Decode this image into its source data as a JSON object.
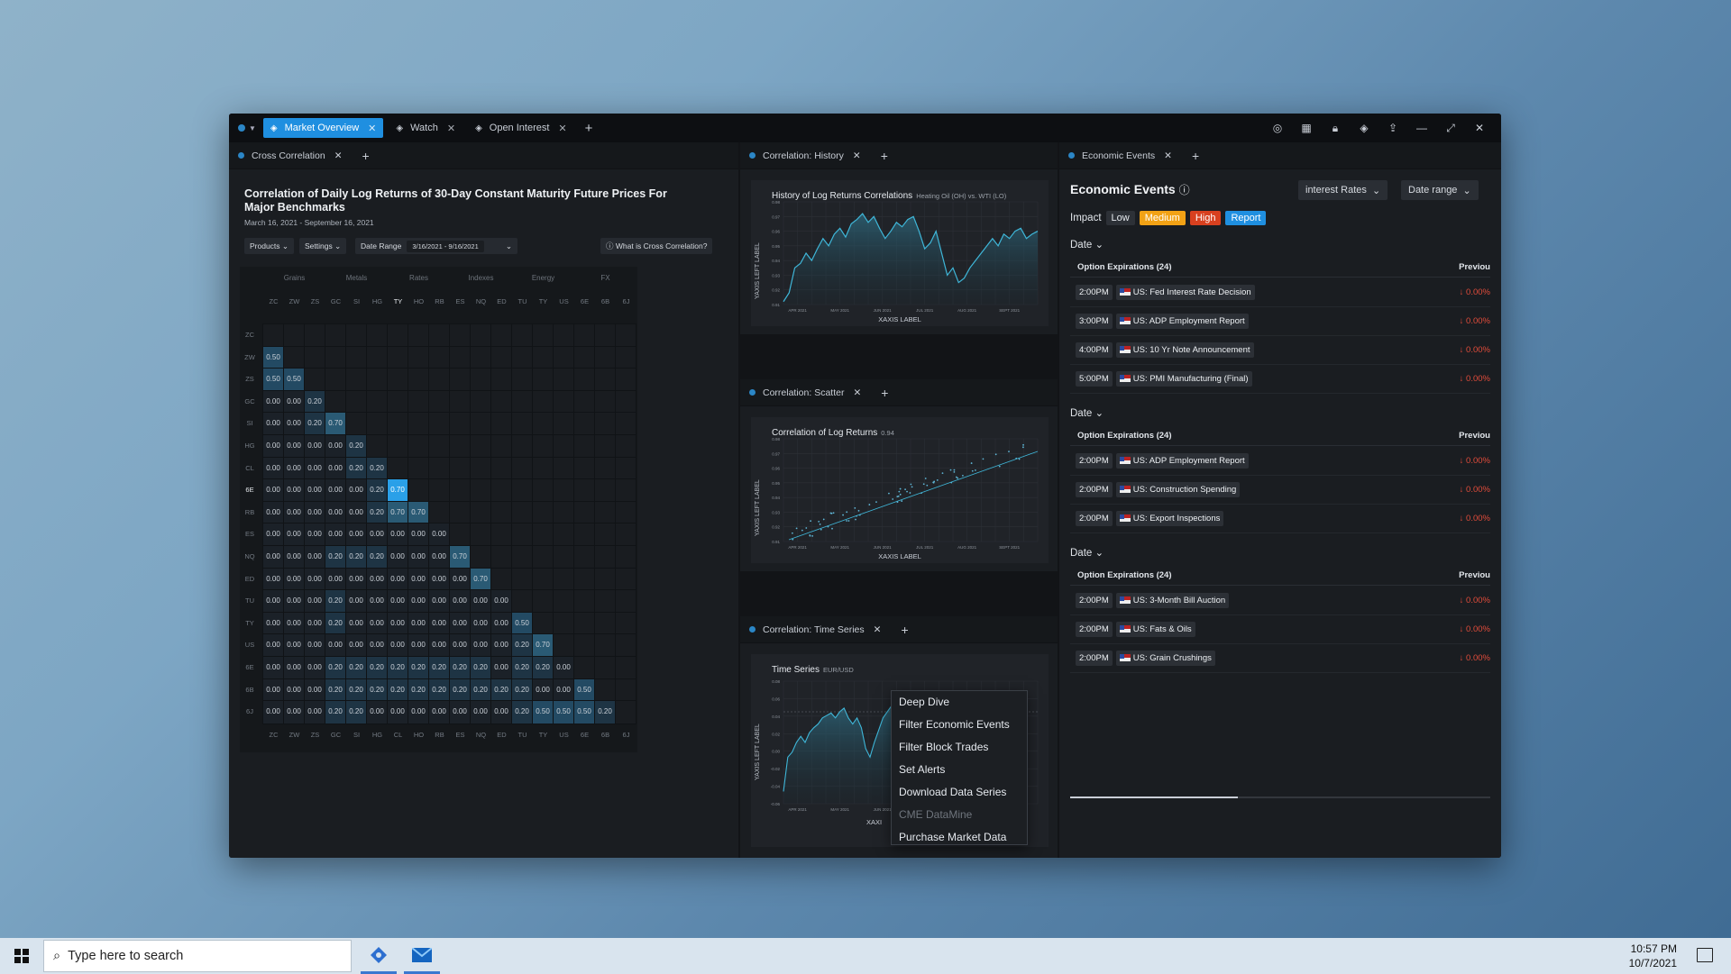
{
  "window": {
    "tabs": [
      {
        "label": "Market Overview",
        "active": true
      },
      {
        "label": "Watch"
      },
      {
        "label": "Open Interest"
      }
    ],
    "controls": [
      "target-icon",
      "grid-icon",
      "lock-icon",
      "layers-icon",
      "share-icon",
      "minimize-icon",
      "expand-icon",
      "close-icon"
    ]
  },
  "cross": {
    "tab": "Cross Correlation",
    "title": "Correlation of Daily Log Returns of 30-Day Constant Maturity Future Prices For Major Benchmarks",
    "date": "March 16, 2021 - September 16, 2021",
    "products": "Products",
    "settings": "Settings",
    "date_range_label": "Date Range",
    "date_range_value": "3/16/2021 - 9/16/2021",
    "help": "What is Cross Correlation?",
    "groups": [
      "Grains",
      "Metals",
      "Rates",
      "Indexes",
      "Energy",
      "FX"
    ],
    "cols": [
      "ZC",
      "ZW",
      "ZS",
      "GC",
      "SI",
      "HG",
      "TY",
      "HO",
      "RB",
      "ES",
      "NQ",
      "ED",
      "TU",
      "TY",
      "US",
      "6E",
      "6B",
      "6J"
    ],
    "rows": [
      "ZC",
      "ZW",
      "ZS",
      "GC",
      "SI",
      "HG",
      "CL",
      "6E",
      "RB",
      "ES",
      "NQ",
      "ED",
      "TU",
      "TY",
      "US",
      "6E",
      "6B",
      "6J"
    ],
    "bottom": [
      "ZC",
      "ZW",
      "ZS",
      "GC",
      "SI",
      "HG",
      "CL",
      "HO",
      "RB",
      "ES",
      "NQ",
      "ED",
      "TU",
      "TY",
      "US",
      "6E",
      "6B",
      "6J"
    ],
    "values": [
      [],
      [
        "0.50"
      ],
      [
        "0.50",
        "0.50"
      ],
      [
        "0.00",
        "0.00",
        "0.20"
      ],
      [
        "0.00",
        "0.00",
        "0.20",
        "0.70"
      ],
      [
        "0.00",
        "0.00",
        "0.00",
        "0.00",
        "0.20"
      ],
      [
        "0.00",
        "0.00",
        "0.00",
        "0.00",
        "0.20",
        "0.20"
      ],
      [
        "0.00",
        "0.00",
        "0.00",
        "0.00",
        "0.00",
        "0.20",
        "0.70"
      ],
      [
        "0.00",
        "0.00",
        "0.00",
        "0.00",
        "0.00",
        "0.20",
        "0.70",
        "0.70"
      ],
      [
        "0.00",
        "0.00",
        "0.00",
        "0.00",
        "0.00",
        "0.00",
        "0.00",
        "0.00",
        "0.00"
      ],
      [
        "0.00",
        "0.00",
        "0.00",
        "0.20",
        "0.20",
        "0.20",
        "0.00",
        "0.00",
        "0.00",
        "0.70"
      ],
      [
        "0.00",
        "0.00",
        "0.00",
        "0.00",
        "0.00",
        "0.00",
        "0.00",
        "0.00",
        "0.00",
        "0.00",
        "0.70"
      ],
      [
        "0.00",
        "0.00",
        "0.00",
        "0.20",
        "0.00",
        "0.00",
        "0.00",
        "0.00",
        "0.00",
        "0.00",
        "0.00",
        "0.00"
      ],
      [
        "0.00",
        "0.00",
        "0.00",
        "0.20",
        "0.00",
        "0.00",
        "0.00",
        "0.00",
        "0.00",
        "0.00",
        "0.00",
        "0.00",
        "0.50"
      ],
      [
        "0.00",
        "0.00",
        "0.00",
        "0.00",
        "0.00",
        "0.00",
        "0.00",
        "0.00",
        "0.00",
        "0.00",
        "0.00",
        "0.00",
        "0.20",
        "0.70"
      ],
      [
        "0.00",
        "0.00",
        "0.00",
        "0.20",
        "0.20",
        "0.20",
        "0.20",
        "0.20",
        "0.20",
        "0.20",
        "0.20",
        "0.00",
        "0.20",
        "0.20",
        "0.00"
      ],
      [
        "0.00",
        "0.00",
        "0.00",
        "0.20",
        "0.20",
        "0.20",
        "0.20",
        "0.20",
        "0.20",
        "0.20",
        "0.20",
        "0.20",
        "0.20",
        "0.00",
        "0.00",
        "0.50"
      ],
      [
        "0.00",
        "0.00",
        "0.00",
        "0.20",
        "0.20",
        "0.00",
        "0.00",
        "0.00",
        "0.00",
        "0.00",
        "0.00",
        "0.00",
        "0.20",
        "0.50",
        "0.50",
        "0.50",
        "0.20"
      ]
    ]
  },
  "history": {
    "tab": "Correlation: History",
    "title": "History of Log Returns Correlations",
    "subtitle": "Heating Oil (OH) vs. WTI (LO)",
    "ylabel": "YAXIS LEFT LABEL",
    "xlabel": "XAXIS LABEL",
    "xticks": [
      "APR 2021",
      "MAY 2021",
      "JUN 2021",
      "JUL 2021",
      "AUG 2021",
      "SEPT 2021"
    ],
    "yticks": [
      "0.98",
      "0.97",
      "0.96",
      "0.95",
      "0.94",
      "0.93",
      "0.92",
      "0.91"
    ],
    "series": [
      0.912,
      0.918,
      0.935,
      0.938,
      0.945,
      0.94,
      0.948,
      0.955,
      0.95,
      0.958,
      0.962,
      0.956,
      0.965,
      0.968,
      0.972,
      0.966,
      0.97,
      0.962,
      0.955,
      0.96,
      0.966,
      0.963,
      0.968,
      0.97,
      0.96,
      0.948,
      0.952,
      0.96,
      0.945,
      0.93,
      0.935,
      0.925,
      0.928,
      0.935,
      0.94,
      0.945,
      0.95,
      0.955,
      0.95,
      0.958,
      0.955,
      0.96,
      0.962,
      0.955,
      0.958,
      0.96
    ]
  },
  "scatter": {
    "tab": "Correlation: Scatter",
    "title": "Correlation of Log Returns",
    "subtitle": "0.94",
    "ylabel": "YAXIS LEFT LABEL",
    "xlabel": "XAXIS LABEL",
    "xticks": [
      "APR 2021",
      "MAY 2021",
      "JUN 2021",
      "JUL 2021",
      "AUG 2021",
      "SEPT 2021"
    ],
    "yticks": [
      "0.98",
      "0.97",
      "0.96",
      "0.95",
      "0.94",
      "0.93",
      "0.92",
      "0.91"
    ]
  },
  "timeseries": {
    "tab": "Correlation: Time Series",
    "title": "Time Series",
    "subtitle": "EUR/USD",
    "ylabel": "YAXIS LEFT LABEL",
    "xlabel": "XAXI",
    "xticks": [
      "APR 2021",
      "MAY 2021",
      "JUN 2021"
    ],
    "yticks": [
      "0.08",
      "0.06",
      "0.04",
      "0.02",
      "0.00",
      "-0.02",
      "-0.04",
      "-0.06"
    ]
  },
  "context_menu": [
    "Deep Dive",
    "Filter Economic Events",
    "Filter Block Trades",
    "Set Alerts",
    "Download Data Series",
    "CME DataMine",
    "Purchase Market Data"
  ],
  "events": {
    "tab": "Economic Events",
    "title": "Economic Events",
    "filter1": "interest Rates",
    "filter2": "Date range",
    "impact_label": "Impact",
    "impacts": [
      {
        "label": "Low",
        "color": "#2d3137"
      },
      {
        "label": "Medium",
        "color": "#f2a215"
      },
      {
        "label": "High",
        "color": "#d8401f"
      },
      {
        "label": "Report",
        "color": "#1f8fe0"
      }
    ],
    "groups": [
      {
        "date": "Date",
        "header": "Option Expirations (24)",
        "prev": "Previou",
        "rows": [
          {
            "time": "2:00PM",
            "name": "US: Fed Interest Rate Decision",
            "val": "↓ 0.00%"
          },
          {
            "time": "3:00PM",
            "name": "US: ADP Employment Report",
            "val": "↓ 0.00%"
          },
          {
            "time": "4:00PM",
            "name": "US: 10 Yr Note Announcement",
            "val": "↓ 0.00%"
          },
          {
            "time": "5:00PM",
            "name": "US: PMI Manufacturing (Final)",
            "val": "↓ 0.00%"
          }
        ]
      },
      {
        "date": "Date",
        "header": "Option Expirations (24)",
        "prev": "Previou",
        "rows": [
          {
            "time": "2:00PM",
            "name": "US: ADP Employment Report",
            "val": "↓ 0.00%"
          },
          {
            "time": "2:00PM",
            "name": "US: Construction Spending",
            "val": "↓ 0.00%"
          },
          {
            "time": "2:00PM",
            "name": "US: Export Inspections",
            "val": "↓ 0.00%"
          }
        ]
      },
      {
        "date": "Date",
        "header": "Option Expirations (24)",
        "prev": "Previou",
        "rows": [
          {
            "time": "2:00PM",
            "name": "US: 3-Month Bill Auction",
            "val": "↓ 0.00%"
          },
          {
            "time": "2:00PM",
            "name": "US: Fats & Oils",
            "val": "↓ 0.00%"
          },
          {
            "time": "2:00PM",
            "name": "US: Grain Crushings",
            "val": "↓ 0.00%"
          }
        ]
      }
    ]
  },
  "taskbar": {
    "search_placeholder": "Type here to search",
    "time": "10:57 PM",
    "date": "10/7/2021"
  }
}
